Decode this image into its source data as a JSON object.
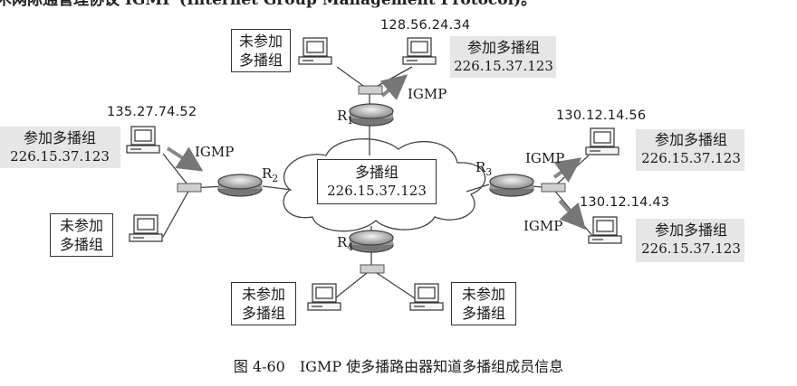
{
  "top_text": "术网际通管理协议 IGMP (Internet Group Management Protocol)。",
  "center_group": {
    "line1": "多播组",
    "line2": "226.15.37.123"
  },
  "igmp_label": "IGMP",
  "routers": {
    "r1": "R1",
    "r2": "R2",
    "r3": "R3",
    "r4": "R4"
  },
  "hosts": {
    "top_left": {
      "line1": "未参加",
      "line2": "多播组"
    },
    "top_right": {
      "ip": "128.56.24.34",
      "line1": "参加多播组",
      "line2": "226.15.37.123"
    },
    "left_top": {
      "ip": "135.27.74.52",
      "line1": "参加多播组",
      "line2": "226.15.37.123"
    },
    "left_bottom": {
      "line1": "未参加",
      "line2": "多播组"
    },
    "right_top": {
      "ip": "130.12.14.56",
      "line1": "参加多播组",
      "line2": "226.15.37.123"
    },
    "right_bottom": {
      "ip": "130.12.14.43",
      "line1": "参加多播组",
      "line2": "226.15.37.123"
    },
    "bottom_left": {
      "line1": "未参加",
      "line2": "多播组"
    },
    "bottom_right": {
      "line1": "未参加",
      "line2": "多播组"
    }
  },
  "caption": "图 4-60　IGMP 使多播路由器知道多播组成员信息"
}
